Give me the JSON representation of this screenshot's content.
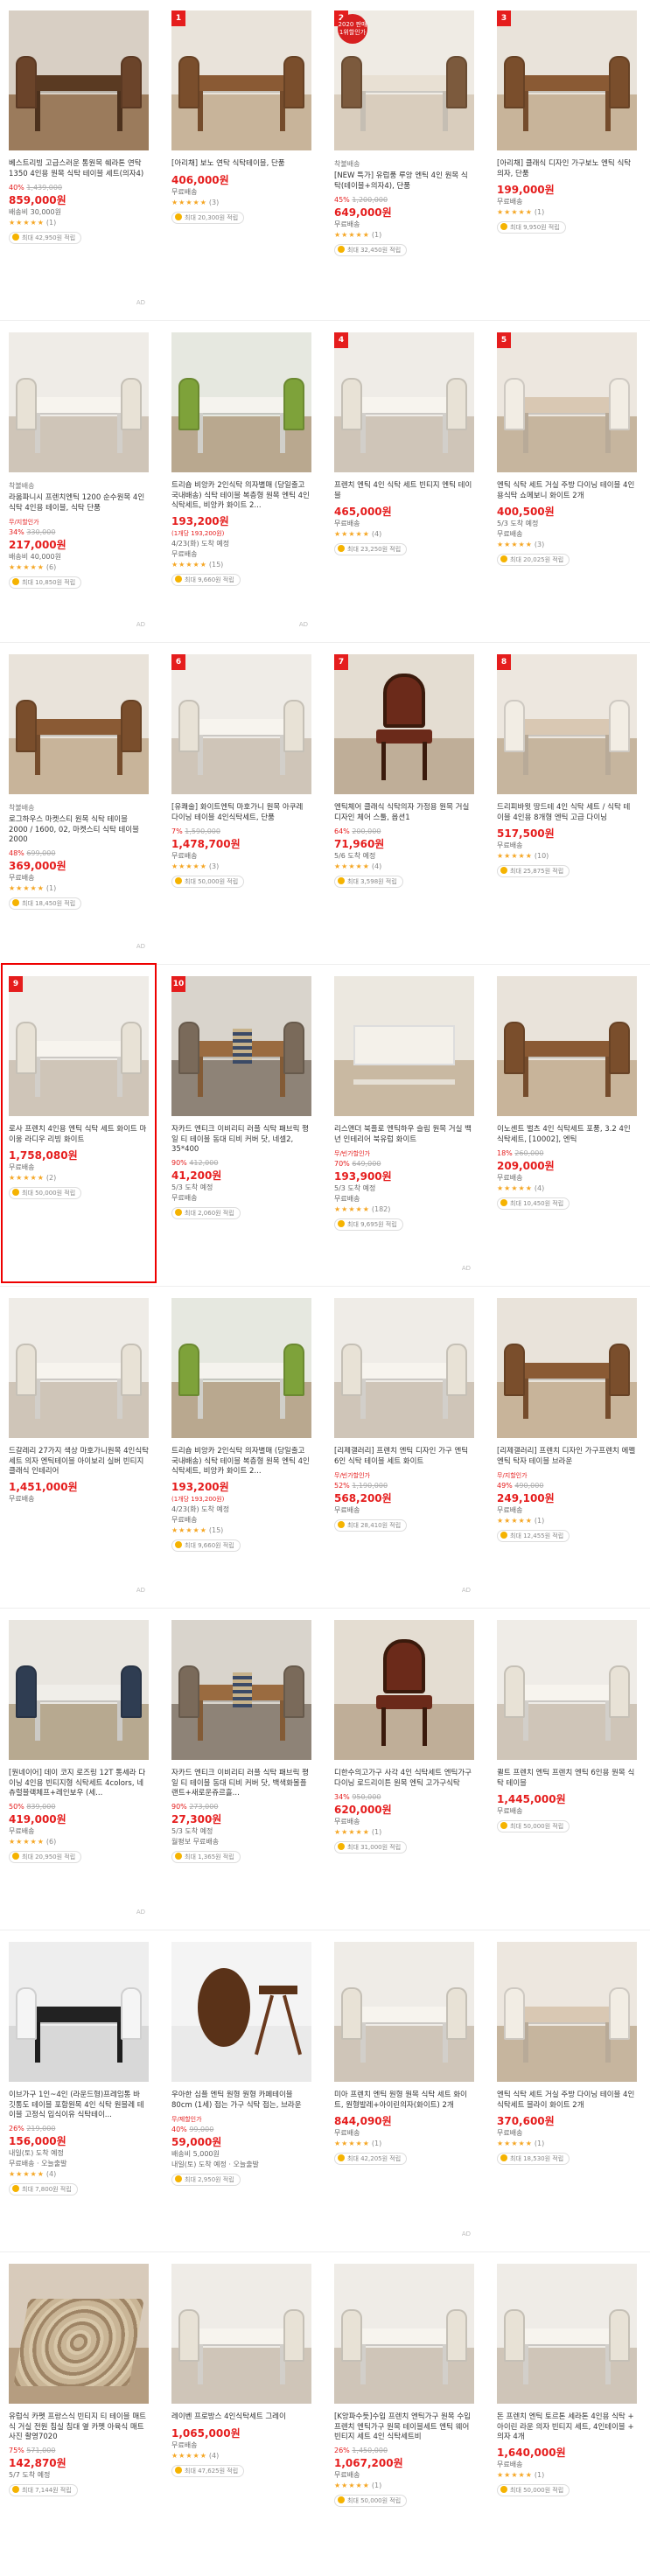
{
  "ad_label": "AD",
  "cards": [
    {
      "col": 0,
      "row": 0,
      "title": "베스트리빙 고급스러운 통원목 쉐라톤 연탁 1350 4인용 원목 식탁 테이블 세트(의자4)",
      "discount_pct": "40%",
      "orig_price": "1,439,000",
      "price": "859,000원",
      "ship": "배송비 30,000원",
      "stars": "★★★★★",
      "count": "(1)",
      "points": "최대 42,950원 적립",
      "ad": true,
      "theme": "brown"
    },
    {
      "col": 1,
      "row": 0,
      "rank": "1",
      "title": "[아리채] 보노 연탁 식탁테이블, 단품",
      "price": "406,000원",
      "ship": "무료배송",
      "stars": "★★★★★",
      "count": "(3)",
      "points": "최대 20,300원 적립",
      "theme": "wood"
    },
    {
      "col": 2,
      "row": 0,
      "rank": "2",
      "badge": "2020 판매 1위할인가",
      "pre": "착불배송",
      "title": "[NEW 특가] 유럽풍 루앙 엔틱 4인 원목 식탁(테이블+의자4), 단품",
      "discount_pct": "45%",
      "orig_price": "1,200,000",
      "price": "649,000원",
      "ship": "무료배송",
      "stars": "★★★★★",
      "count": "(1)",
      "points": "최대 32,450원 적립",
      "theme": "light"
    },
    {
      "col": 3,
      "row": 0,
      "rank": "3",
      "title": "[아리채] 클래식 디자인 가구보노 엔틱 식탁의자, 단품",
      "price": "199,000원",
      "ship": "무료배송",
      "stars": "★★★★★",
      "count": "(1)",
      "points": "최대 9,950원 적립",
      "theme": "wood"
    },
    {
      "col": 0,
      "row": 1,
      "pre": "착불배송",
      "title": "라움파니시 프렌치엔틱 1200 순수원목 4인 식탁 4인용 테이블, 식탁 단품",
      "sub": "무/지할인가",
      "discount_pct": "34%",
      "orig_price": "330,000",
      "price": "217,000원",
      "ship": "배송비 40,000원",
      "stars": "★★★★★",
      "count": "(6)",
      "points": "최대 10,850원 적립",
      "ad": true,
      "theme": "white"
    },
    {
      "col": 1,
      "row": 1,
      "title": "트리숍 비앙카 2인식탁 의자별매 (당일출고 국내배송) 식탁 테이블 복층형 원목 엔틱 4인식탁세트, 비앙카 화이트 2...",
      "price": "193,200원",
      "sub": "(1개당 193,200원)",
      "ship": "4/23(화) 도착 예정",
      "ship2": "무료배송",
      "stars": "★★★★★",
      "count": "(15)",
      "points": "최대 9,660원 적립",
      "ad": true,
      "theme": "green"
    },
    {
      "col": 2,
      "row": 1,
      "rank": "4",
      "title": "프렌치 엔틱 4인 식탁 세트 빈티지 엔틱 테이블",
      "price": "465,000원",
      "ship": "무료배송",
      "stars": "★★★★★",
      "count": "(4)",
      "points": "최대 23,250원 적립",
      "theme": "white"
    },
    {
      "col": 3,
      "row": 1,
      "rank": "5",
      "title": "엔틱 식탁 세트 거실 주방 다이닝 테이블 4인용식탁 쇼메보니 화이트 2개",
      "price": "400,500원",
      "ship": "5/3 도착 예정",
      "ship2": "무료배송",
      "stars": "★★★★★",
      "count": "(3)",
      "points": "최대 20,025원 적립",
      "theme": "marble"
    },
    {
      "col": 0,
      "row": 2,
      "pre": "착불배송",
      "title": "로그하우스 마켓스티 원목 식탁 테이블 2000 / 1600, 02, 마켓스티 식탁 테이블 2000",
      "discount_pct": "48%",
      "orig_price": "699,000",
      "price": "369,000원",
      "ship": "무료배송",
      "stars": "★★★★★",
      "count": "(1)",
      "points": "최대 18,450원 적립",
      "ad": true,
      "theme": "wood"
    },
    {
      "col": 1,
      "row": 2,
      "rank": "6",
      "title": "[유쾌술] 화이트엔틱 마호가니 원목 아쿠레 다이닝 테이블 4인식탁세트, 단품",
      "discount_pct": "7%",
      "orig_price": "1,590,000",
      "price": "1,478,700원",
      "ship": "무료배송",
      "stars": "★★★★★",
      "count": "(3)",
      "points": "최대 50,000원 적립",
      "theme": "white"
    },
    {
      "col": 2,
      "row": 2,
      "rank": "7",
      "title": "엔틱체어 클래식 식탁의자 가정용 원목 거실 디자인 체어 스툴, 옵션1",
      "discount_pct": "64%",
      "orig_price": "200,000",
      "price": "71,960원",
      "ship": "5/6 도착 예정",
      "stars": "★★★★★",
      "count": "(4)",
      "points": "최대 3,598원 적립",
      "theme": "chair"
    },
    {
      "col": 3,
      "row": 2,
      "rank": "8",
      "title": "드리피바윗 땅드테 4인 식탁 세트 / 식탁 테이블 4인용 8개형 엔틱 고급 다이닝",
      "price": "517,500원",
      "ship": "무료배송",
      "stars": "★★★★★",
      "count": "(10)",
      "points": "최대 25,875원 적립",
      "theme": "marble"
    },
    {
      "col": 0,
      "row": 3,
      "rank": "9",
      "hl": true,
      "title": "로사 프렌치 4인용 엔틱 식탁 세트 화이트 마이웅 라디우 리빙 화이트",
      "price": "1,758,080원",
      "ship": "무료배송",
      "stars": "★★★★★",
      "count": "(2)",
      "points": "최대 50,000원 적립",
      "theme": "white"
    },
    {
      "col": 1,
      "row": 3,
      "rank": "10",
      "title": "자카드 엔티크 이비리티 러플 식탁 패브릭 평일 티 테이블 동대 티비 커버 닷, 네셀2, 35*400",
      "discount_pct": "90%",
      "orig_price": "412,000",
      "price": "41,200원",
      "ship": "5/3 도착 예정",
      "ship2": "무료배송",
      "points": "최대 2,060원 적립",
      "theme": "runner"
    },
    {
      "col": 2,
      "row": 3,
      "title": "리스앤더 북플로 엔틱하우 슬림 원목 거실 백년 인테리어 북유럽 화이트",
      "sub": "무/빈가할인가",
      "discount_pct": "70%",
      "orig_price": "649,000",
      "price": "193,900원",
      "ship": "5/3 도착 예정",
      "ship2": "무료배송",
      "stars": "★★★★★",
      "count": "(182)",
      "points": "최대 9,695원 적립",
      "ad": true,
      "theme": "console"
    },
    {
      "col": 3,
      "row": 3,
      "title": "이노센트 벌츠 4인 식탁세트 포풍, 3.2 4인 식탁세트, [10002], 엔틱",
      "discount_pct": "18%",
      "orig_price": "260,000",
      "price": "209,000원",
      "ship": "무료배송",
      "stars": "★★★★★",
      "count": "(4)",
      "points": "최대 10,450원 적립",
      "theme": "wood"
    },
    {
      "col": 0,
      "row": 4,
      "title": "드갈레리 27가지 색상 마호가니원목 4인식탁세트 의자 엔틱테이블 아이보리 실버 빈티지 클래식 인테리어",
      "price": "1,451,000원",
      "ship": "무료배송",
      "ad": true,
      "theme": "white"
    },
    {
      "col": 1,
      "row": 4,
      "title": "트리숍 비앙카 2인식탁 의자별매 (당일출고 국내배송) 식탁 테이블 복층형 원목 엔틱 4인식탁세트, 비앙카 화이트 2...",
      "price": "193,200원",
      "sub": "(1개당 193,200원)",
      "ship": "4/23(화) 도착 예정",
      "ship2": "무료배송",
      "stars": "★★★★★",
      "count": "(15)",
      "points": "최대 9,660원 적립",
      "theme": "green"
    },
    {
      "col": 2,
      "row": 4,
      "title": "[리제갤러리] 프렌치 엔틱 디자인 가구 엔틱 6인 식탁 테이블 세트 화이트",
      "sub": "무/빈가할인가",
      "discount_pct": "52%",
      "orig_price": "1,190,000",
      "price": "568,200원",
      "ship": "무료배송",
      "points": "최대 28,410원 적립",
      "ad": true,
      "theme": "white"
    },
    {
      "col": 3,
      "row": 4,
      "title": "[리제갤러리] 프렌치 디자인 가구프렌치 에펠 엔틱 탁자 테이블 브라운",
      "sub": "무/지할인가",
      "discount_pct": "49%",
      "orig_price": "490,000",
      "price": "249,100원",
      "ship": "무료배송",
      "stars": "★★★★★",
      "count": "(1)",
      "points": "최대 12,455원 적립",
      "theme": "wood"
    },
    {
      "col": 0,
      "row": 5,
      "title": "[원네이어] 데이 코지 로즈링 12T 통세라 다이닝 4인용 빈티지형 식탁세트 4colors, 네츄럴블랙체프+레인보우 (세...",
      "discount_pct": "50%",
      "orig_price": "839,000",
      "price": "419,000원",
      "ship": "무료배송",
      "stars": "★★★★★",
      "count": "(6)",
      "points": "최대 20,950원 적립",
      "ad": true,
      "theme": "dark"
    },
    {
      "col": 1,
      "row": 5,
      "title": "자카드 엔티크 이비리티 러플 식탁 패브릭 평일 티 테이블 동대 티비 커버 닷, 백색화볼플랜트+새로운쥬르흘...",
      "discount_pct": "90%",
      "orig_price": "273,000",
      "price": "27,300원",
      "ship": "5/3 도착 예정",
      "ship2": "월평보 무료배송",
      "points": "최대 1,365원 적립",
      "theme": "runner"
    },
    {
      "col": 2,
      "row": 5,
      "title": "디한수의고가구 사각 4인 식탁세트 엔틱가구 다이닝 로드리이튼 원목 엔틱 고가구식탁",
      "discount_pct": "34%",
      "orig_price": "950,000",
      "price": "620,000원",
      "ship": "무료배송",
      "stars": "★★★★★",
      "count": "(1)",
      "points": "최대 31,000원 적립",
      "theme": "chair"
    },
    {
      "col": 3,
      "row": 5,
      "title": "퀼트 프렌치 엔틱 프렌치 엔틱 6인용 원목 식탁 테이블",
      "price": "1,445,000원",
      "ship": "무료배송",
      "points": "최대 50,000원 적립",
      "theme": "white"
    },
    {
      "col": 0,
      "row": 6,
      "title": "이브가구 1인~4인 (라운드형)프레임통 바 깃통도 테이블 포함원목 4인 식탁 원블레 테이블 고정식 입식이유 식탁테이...",
      "discount_pct": "26%",
      "orig_price": "219,000",
      "price": "156,000원",
      "ship": "내일(토) 도착 예정",
      "ship2": "무료배송 · 오늘출발",
      "stars": "★★★★★",
      "count": "(4)",
      "points": "최대 7,800원 적립",
      "theme": "black"
    },
    {
      "col": 1,
      "row": 6,
      "title": "우아한 심플 엔틱 원형 원형 카페테이블 80cm (1세) 접는 가구 식탁 접는, 브라운",
      "sub": "무/제할인가",
      "discount_pct": "40%",
      "orig_price": "99,000",
      "price": "59,000원",
      "ship": "배송비 5,000원",
      "ship2": "내일(토) 도착 예정 · 오늘출발",
      "points": "최대 2,950원 적립",
      "theme": "round"
    },
    {
      "col": 2,
      "row": 6,
      "title": "미아 프렌치 엔틱 원형 원목 식탁 세트 화이트, 원형발레+아이린의자(화이트) 2개",
      "price": "844,090원",
      "ship": "무료배송",
      "stars": "★★★★★",
      "count": "(1)",
      "points": "최대 42,205원 적립",
      "ad": true,
      "theme": "white"
    },
    {
      "col": 3,
      "row": 6,
      "title": "엔틱 식탁 세트 거실 주방 다이닝 테이블 4인 식탁세트 블라이 화이트 2개",
      "price": "370,600원",
      "ship": "무료배송",
      "stars": "★★★★★",
      "count": "(1)",
      "points": "최대 18,530원 적립",
      "theme": "marble"
    },
    {
      "col": 0,
      "row": 7,
      "title": "유럽식 카펫 프랑스식 빈티지 티 테이블 매트 식 거실 전원 침실 침대 옆 카펫 아육식 매트 사진 촬영7020",
      "discount_pct": "75%",
      "orig_price": "571,000",
      "price": "142,870원",
      "ship": "5/7 도착 예정",
      "points": "최대 7,144원 적립",
      "theme": "rug"
    },
    {
      "col": 1,
      "row": 7,
      "title": "레이벤 프로방스 4인식탁세트 그레이",
      "price": "1,065,000원",
      "ship": "무료배송",
      "stars": "★★★★★",
      "count": "(4)",
      "points": "최대 47,625원 적립",
      "theme": "white"
    },
    {
      "col": 2,
      "row": 7,
      "title": "[K앙파수듯]수입 프렌치 엔틱가구 원목 수입 프렌치 엔틱가구 원목 테이블세트 엔틱 웨어 빈티지 세트 4인 식탁세트비",
      "discount_pct": "26%",
      "orig_price": "1,450,000",
      "price": "1,067,200원",
      "ship": "무료배송",
      "stars": "★★★★★",
      "count": "(1)",
      "points": "최대 50,000원 적립",
      "theme": "white"
    },
    {
      "col": 3,
      "row": 7,
      "title": "돈 프렌치 엔틱 토르톤 세라톤 4인용 식탁 + 아이린 라운 의자 빈티지 세트, 4인테이블 + 의자 4개",
      "price": "1,640,000원",
      "ship": "무료배송",
      "stars": "★★★★★",
      "count": "(1)",
      "points": "최대 50,000원 적립",
      "theme": "white"
    }
  ]
}
